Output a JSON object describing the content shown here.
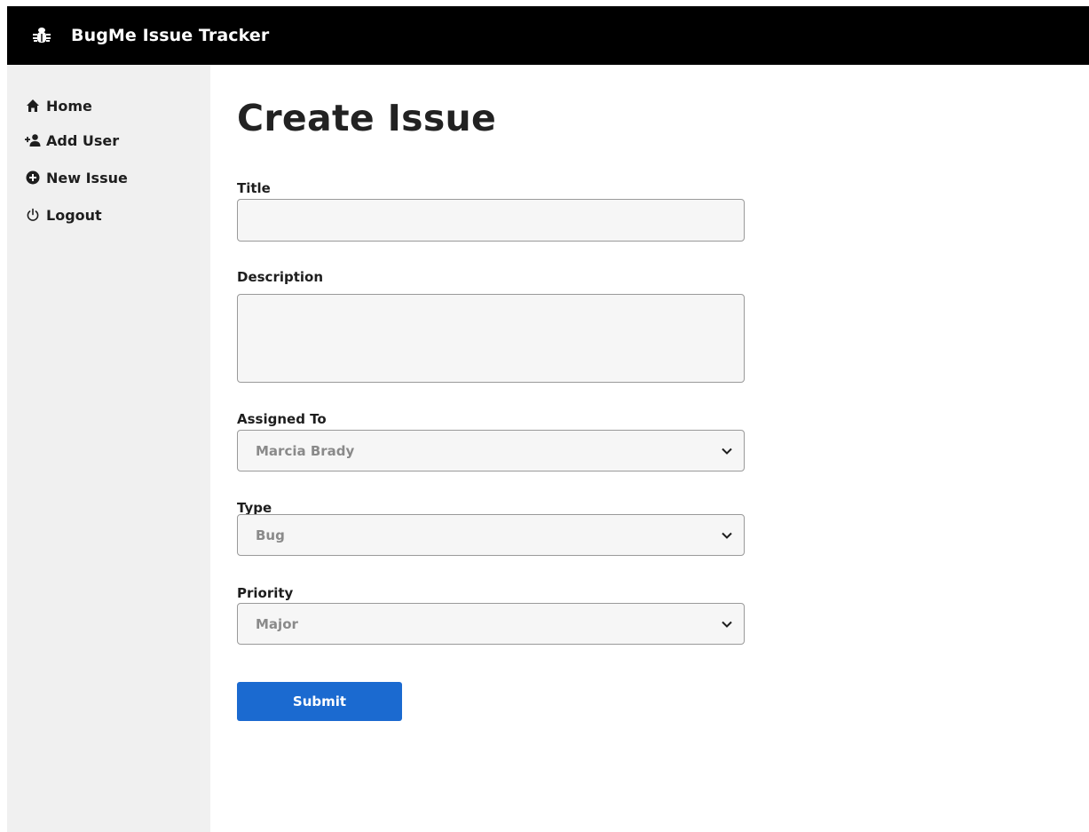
{
  "header": {
    "title": "BugMe Issue Tracker",
    "logo_icon": "bug-icon"
  },
  "sidebar": {
    "items": [
      {
        "label": "Home",
        "icon": "home-icon"
      },
      {
        "label": "Add User",
        "icon": "add-user-icon"
      },
      {
        "label": "New Issue",
        "icon": "plus-circle-icon"
      },
      {
        "label": "Logout",
        "icon": "power-icon"
      }
    ]
  },
  "form": {
    "page_title": "Create Issue",
    "title_label": "Title",
    "title_value": "",
    "description_label": "Description",
    "description_value": "",
    "assigned_label": "Assigned To",
    "assigned_value": "Marcia Brady",
    "type_label": "Type",
    "type_value": "Bug",
    "priority_label": "Priority",
    "priority_value": "Major",
    "submit_label": "Submit"
  },
  "colors": {
    "header_bg": "#000000",
    "sidebar_bg": "#f0f0f0",
    "accent": "#1b6ad0",
    "input_bg": "#f6f6f6"
  }
}
